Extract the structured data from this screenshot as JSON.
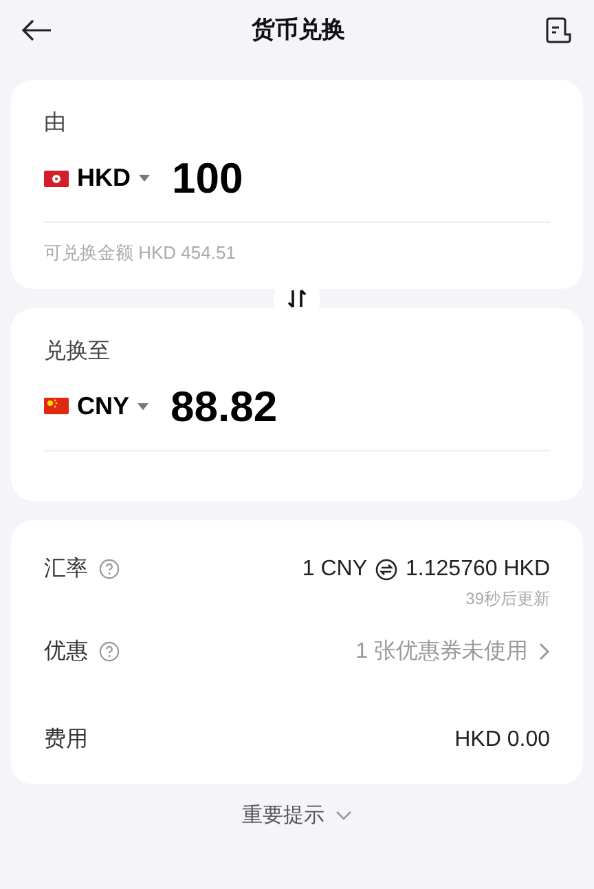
{
  "header": {
    "title": "货币兑换"
  },
  "from": {
    "label": "由",
    "flag": {
      "kind": "hk"
    },
    "currency": "HKD",
    "amount": "100",
    "available": "可兑换金额 HKD 454.51"
  },
  "to": {
    "label": "兑换至",
    "flag": {
      "kind": "cn"
    },
    "currency": "CNY",
    "amount": "88.82"
  },
  "details": [
    {
      "kind": "rate",
      "label": "汇率",
      "help": true,
      "left": "1 CNY",
      "right": "1.125760 HKD",
      "note": "39秒后更新"
    },
    {
      "kind": "link",
      "label": "优惠",
      "help": true,
      "value": "1 张优惠券未使用"
    },
    {
      "kind": "plain",
      "label": "费用",
      "help": false,
      "value": "HKD 0.00"
    }
  ],
  "notice": {
    "label": "重要提示",
    "expanded": false
  }
}
